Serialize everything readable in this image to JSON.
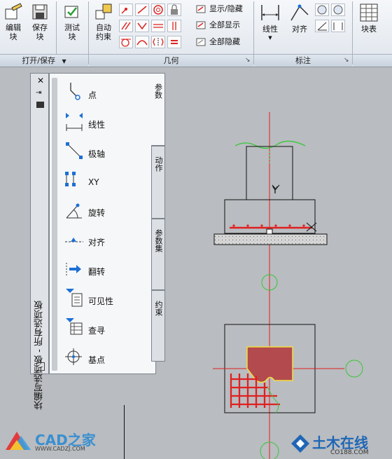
{
  "ribbon": {
    "groups": [
      "打开/保存",
      "几何",
      "标注"
    ],
    "buttons": {
      "edit_block": "编辑\n块",
      "save_block": "保存\n块",
      "test_block": "测试\n块",
      "auto_constrain": "自动\n约束",
      "linear": "线性",
      "aligned": "对齐",
      "block_table": "块表"
    },
    "text_buttons": [
      "显示/隐藏",
      "全部显示",
      "全部隐藏"
    ]
  },
  "palette": {
    "title": "块编写选项板 - 所有选项板",
    "items": [
      "点",
      "线性",
      "极轴",
      "XY",
      "旋转",
      "对齐",
      "翻转",
      "可见性",
      "查寻",
      "基点"
    ],
    "tabs": [
      "参数",
      "动作",
      "参数集",
      "约束"
    ],
    "active_tab": "参数"
  },
  "drawing": {
    "y_label": "Y"
  },
  "watermarks": {
    "left_brand": "CAD之家",
    "left_url": "WWW.CADZJ.COM",
    "right_brand": "土木在线",
    "right_url": "CO188.COM"
  },
  "colors": {
    "accent_red": "#e02020",
    "fill_red": "#b34a4e",
    "highlight_yellow": "#f0e040",
    "green": "#39c639"
  }
}
